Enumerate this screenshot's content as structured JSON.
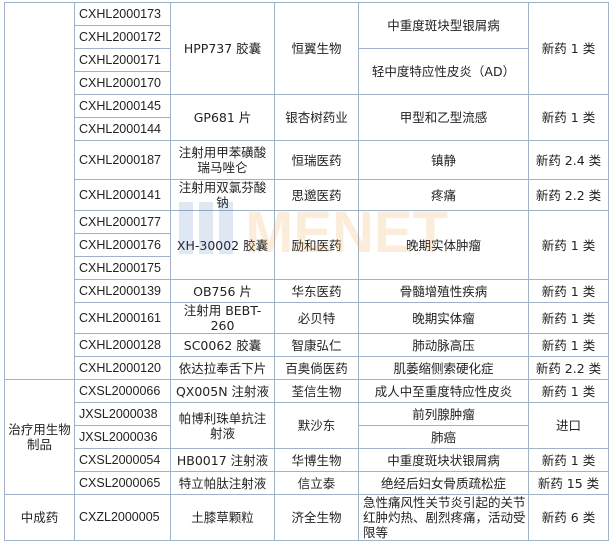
{
  "rows": [
    {
      "cat": "",
      "code": "CXHL2000173",
      "drug": "HPP737 胶囊",
      "company": "恒翼生物",
      "indication": "中重度斑块型银屑病",
      "type": "新药 1 类"
    },
    {
      "cat": "",
      "code": "CXHL2000172",
      "drug": "",
      "company": "",
      "indication": "",
      "type": ""
    },
    {
      "cat": "",
      "code": "CXHL2000171",
      "drug": "",
      "company": "",
      "indication": "轻中度特应性皮炎（AD）",
      "type": ""
    },
    {
      "cat": "",
      "code": "CXHL2000170",
      "drug": "",
      "company": "",
      "indication": "",
      "type": ""
    },
    {
      "cat": "",
      "code": "CXHL2000145",
      "drug": "GP681 片",
      "company": "银杏树药业",
      "indication": "甲型和乙型流感",
      "type": "新药 1 类"
    },
    {
      "cat": "",
      "code": "CXHL2000144",
      "drug": "",
      "company": "",
      "indication": "",
      "type": ""
    },
    {
      "cat": "",
      "code": "CXHL2000187",
      "drug": "注射用甲苯磺酸瑞马唑仑",
      "company": "恒瑞医药",
      "indication": "镇静",
      "type": "新药 2.4 类"
    },
    {
      "cat": "",
      "code": "CXHL2000141",
      "drug": "注射用双氯芬酸钠",
      "company": "思邈医药",
      "indication": "疼痛",
      "type": "新药 2.2 类"
    },
    {
      "cat": "",
      "code": "CXHL2000177",
      "drug": "XH-30002 胶囊",
      "company": "励和医药",
      "indication": "晚期实体肿瘤",
      "type": "新药 1 类"
    },
    {
      "cat": "",
      "code": "CXHL2000176",
      "drug": "",
      "company": "",
      "indication": "",
      "type": ""
    },
    {
      "cat": "",
      "code": "CXHL2000175",
      "drug": "",
      "company": "",
      "indication": "",
      "type": ""
    },
    {
      "cat": "",
      "code": "CXHL2000139",
      "drug": "OB756 片",
      "company": "华东医药",
      "indication": "骨髓增殖性疾病",
      "type": "新药 1 类"
    },
    {
      "cat": "",
      "code": "CXHL2000161",
      "drug": "注射用 BEBT-260",
      "company": "必贝特",
      "indication": "晚期实体瘤",
      "type": "新药 1 类"
    },
    {
      "cat": "",
      "code": "CXHL2000128",
      "drug": "SC0062 胶囊",
      "company": "智康弘仁",
      "indication": "肺动脉高压",
      "type": "新药 1 类"
    },
    {
      "cat": "",
      "code": "CXHL2000120",
      "drug": "依达拉奉舌下片",
      "company": "百奥倘医药",
      "indication": "肌萎缩侧索硬化症",
      "type": "新药 2.2 类"
    },
    {
      "cat": "治疗用生物制品",
      "code": "CXSL2000066",
      "drug": "QX005N 注射液",
      "company": "荃信生物",
      "indication": "成人中至重度特应性皮炎",
      "type": "新药 1 类"
    },
    {
      "cat": "",
      "code": "JXSL2000038",
      "drug": "帕博利珠单抗注射液",
      "company": "默沙东",
      "indication": "前列腺肿瘤",
      "type": "进口"
    },
    {
      "cat": "",
      "code": "JXSL2000036",
      "drug": "",
      "company": "",
      "indication": "肺癌",
      "type": ""
    },
    {
      "cat": "",
      "code": "CXSL2000054",
      "drug": "HB0017 注射液",
      "company": "华博生物",
      "indication": "中重度斑块状银屑病",
      "type": "新药 1 类"
    },
    {
      "cat": "",
      "code": "CXSL2000065",
      "drug": "特立帕肽注射液",
      "company": "信立泰",
      "indication": "绝经后妇女骨质疏松症",
      "type": "新药 15 类"
    },
    {
      "cat": "中成药",
      "code": "CXZL2000005",
      "drug": "土膝草颗粒",
      "company": "济全生物",
      "indication": "急性痛风性关节炎引起的关节红肿灼热、剧烈疼痛，活动受限等",
      "type": "新药 6 类"
    }
  ],
  "watermark": "MENET"
}
